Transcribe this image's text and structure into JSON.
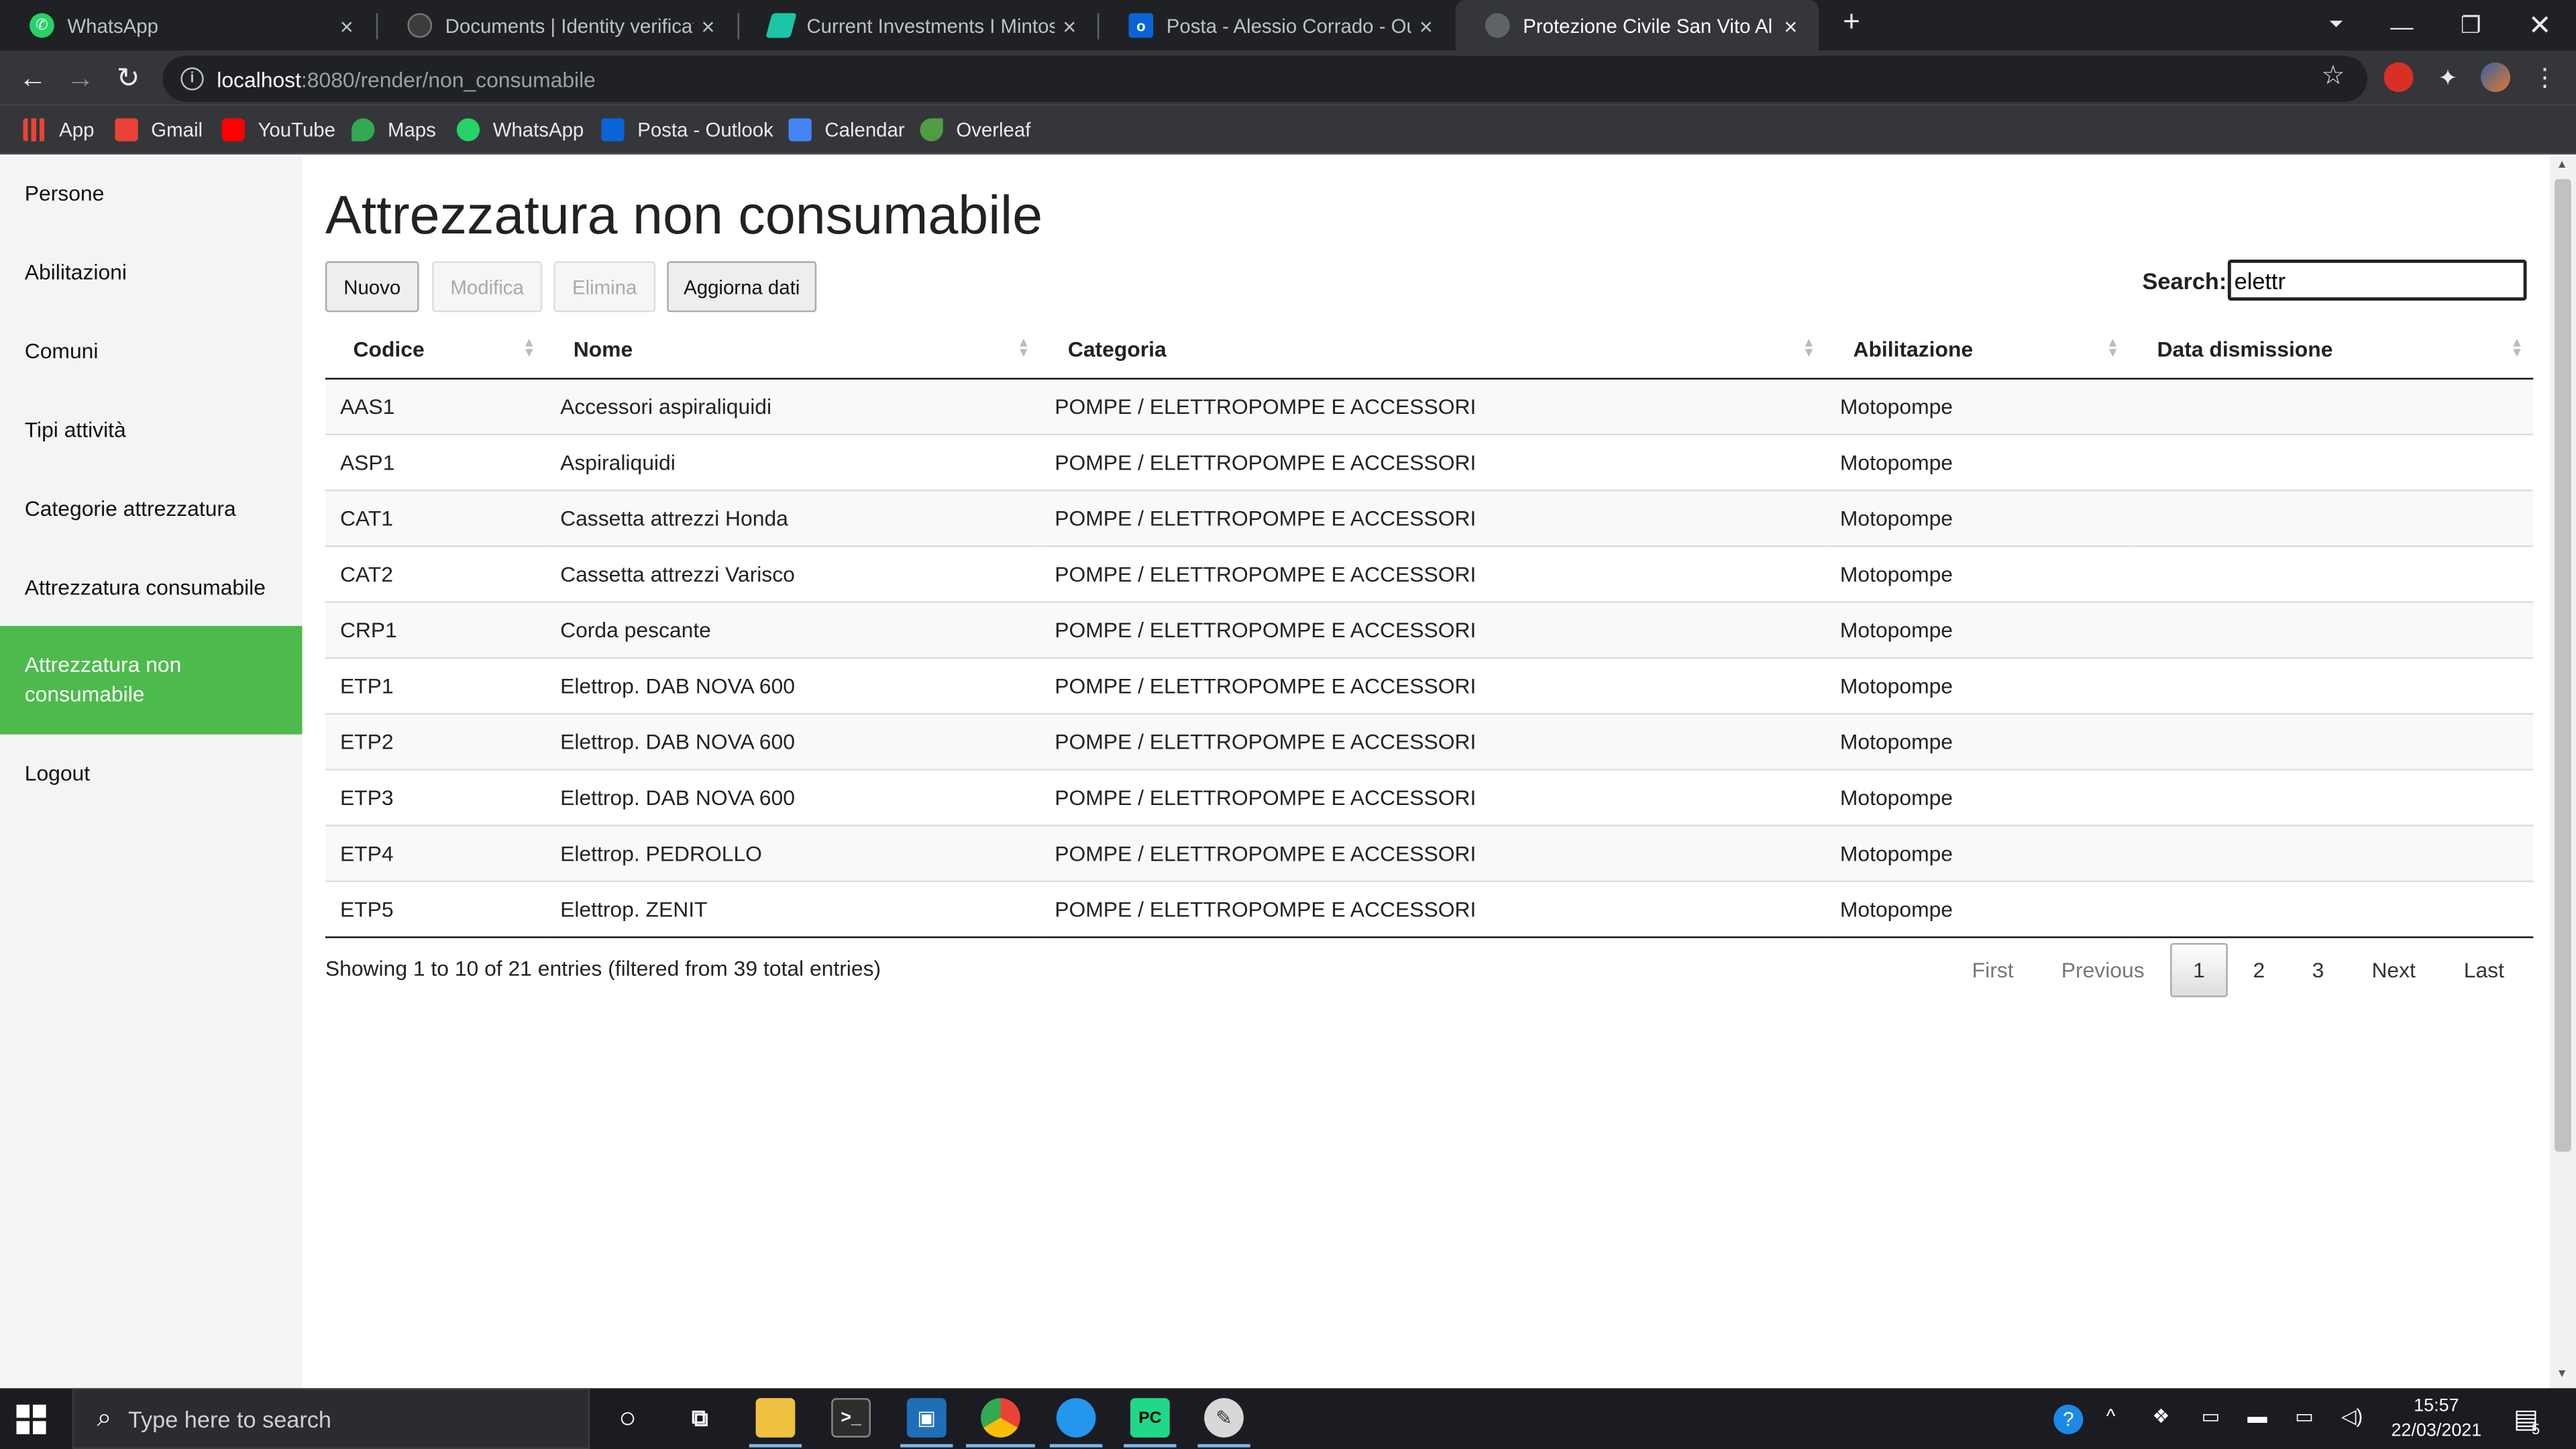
{
  "browser": {
    "tabs": [
      {
        "title": "WhatsApp",
        "active": false
      },
      {
        "title": "Documents | Identity verification",
        "active": false
      },
      {
        "title": "Current Investments I Mintos",
        "active": false
      },
      {
        "title": "Posta - Alessio Corrado - Outlook",
        "active": false
      },
      {
        "title": "Protezione Civile San Vito Al Tagliamento",
        "active": true
      }
    ],
    "url_host": "localhost",
    "url_path": ":8080/render/non_consumabile",
    "bookmarks": [
      "App",
      "Gmail",
      "YouTube",
      "Maps",
      "WhatsApp",
      "Posta - Outlook",
      "Calendar",
      "Overleaf"
    ]
  },
  "sidebar": {
    "items": [
      {
        "label": "Persone"
      },
      {
        "label": "Abilitazioni"
      },
      {
        "label": "Comuni"
      },
      {
        "label": "Tipi attività"
      },
      {
        "label": "Categorie attrezzatura"
      },
      {
        "label": "Attrezzatura consumabile"
      },
      {
        "label": "Attrezzatura non consumabile",
        "active": true
      },
      {
        "label": "Logout"
      }
    ]
  },
  "main": {
    "title": "Attrezzatura non consumabile",
    "buttons": {
      "new": "Nuovo",
      "edit": "Modifica",
      "delete": "Elimina",
      "refresh": "Aggiorna dati"
    },
    "search": {
      "label": "Search:",
      "value": "elettr"
    },
    "table": {
      "columns": [
        "Codice",
        "Nome",
        "Categoria",
        "Abilitazione",
        "Data dismissione"
      ],
      "rows": [
        [
          "AAS1",
          "Accessori aspiraliquidi",
          "POMPE / ELETTROPOMPE E ACCESSORI",
          "Motopompe",
          ""
        ],
        [
          "ASP1",
          "Aspiraliquidi",
          "POMPE / ELETTROPOMPE E ACCESSORI",
          "Motopompe",
          ""
        ],
        [
          "CAT1",
          "Cassetta attrezzi Honda",
          "POMPE / ELETTROPOMPE E ACCESSORI",
          "Motopompe",
          ""
        ],
        [
          "CAT2",
          "Cassetta attrezzi Varisco",
          "POMPE / ELETTROPOMPE E ACCESSORI",
          "Motopompe",
          ""
        ],
        [
          "CRP1",
          "Corda pescante",
          "POMPE / ELETTROPOMPE E ACCESSORI",
          "Motopompe",
          ""
        ],
        [
          "ETP1",
          "Elettrop. DAB NOVA 600",
          "POMPE / ELETTROPOMPE E ACCESSORI",
          "Motopompe",
          ""
        ],
        [
          "ETP2",
          "Elettrop. DAB NOVA 600",
          "POMPE / ELETTROPOMPE E ACCESSORI",
          "Motopompe",
          ""
        ],
        [
          "ETP3",
          "Elettrop. DAB NOVA 600",
          "POMPE / ELETTROPOMPE E ACCESSORI",
          "Motopompe",
          ""
        ],
        [
          "ETP4",
          "Elettrop. PEDROLLO",
          "POMPE / ELETTROPOMPE E ACCESSORI",
          "Motopompe",
          ""
        ],
        [
          "ETP5",
          "Elettrop. ZENIT",
          "POMPE / ELETTROPOMPE E ACCESSORI",
          "Motopompe",
          ""
        ]
      ]
    },
    "info": "Showing 1 to 10 of 21 entries (filtered from 39 total entries)",
    "pagination": {
      "first": "First",
      "previous": "Previous",
      "pages": [
        "1",
        "2",
        "3"
      ],
      "current": "1",
      "next": "Next",
      "last": "Last"
    }
  },
  "taskbar": {
    "search_placeholder": "Type here to search",
    "time": "15:57",
    "date": "22/03/2021",
    "notifications": "5"
  },
  "colors": {
    "accent": "#4cbb4c",
    "chrome_dark": "#202124",
    "chrome_toolbar": "#35363a"
  }
}
